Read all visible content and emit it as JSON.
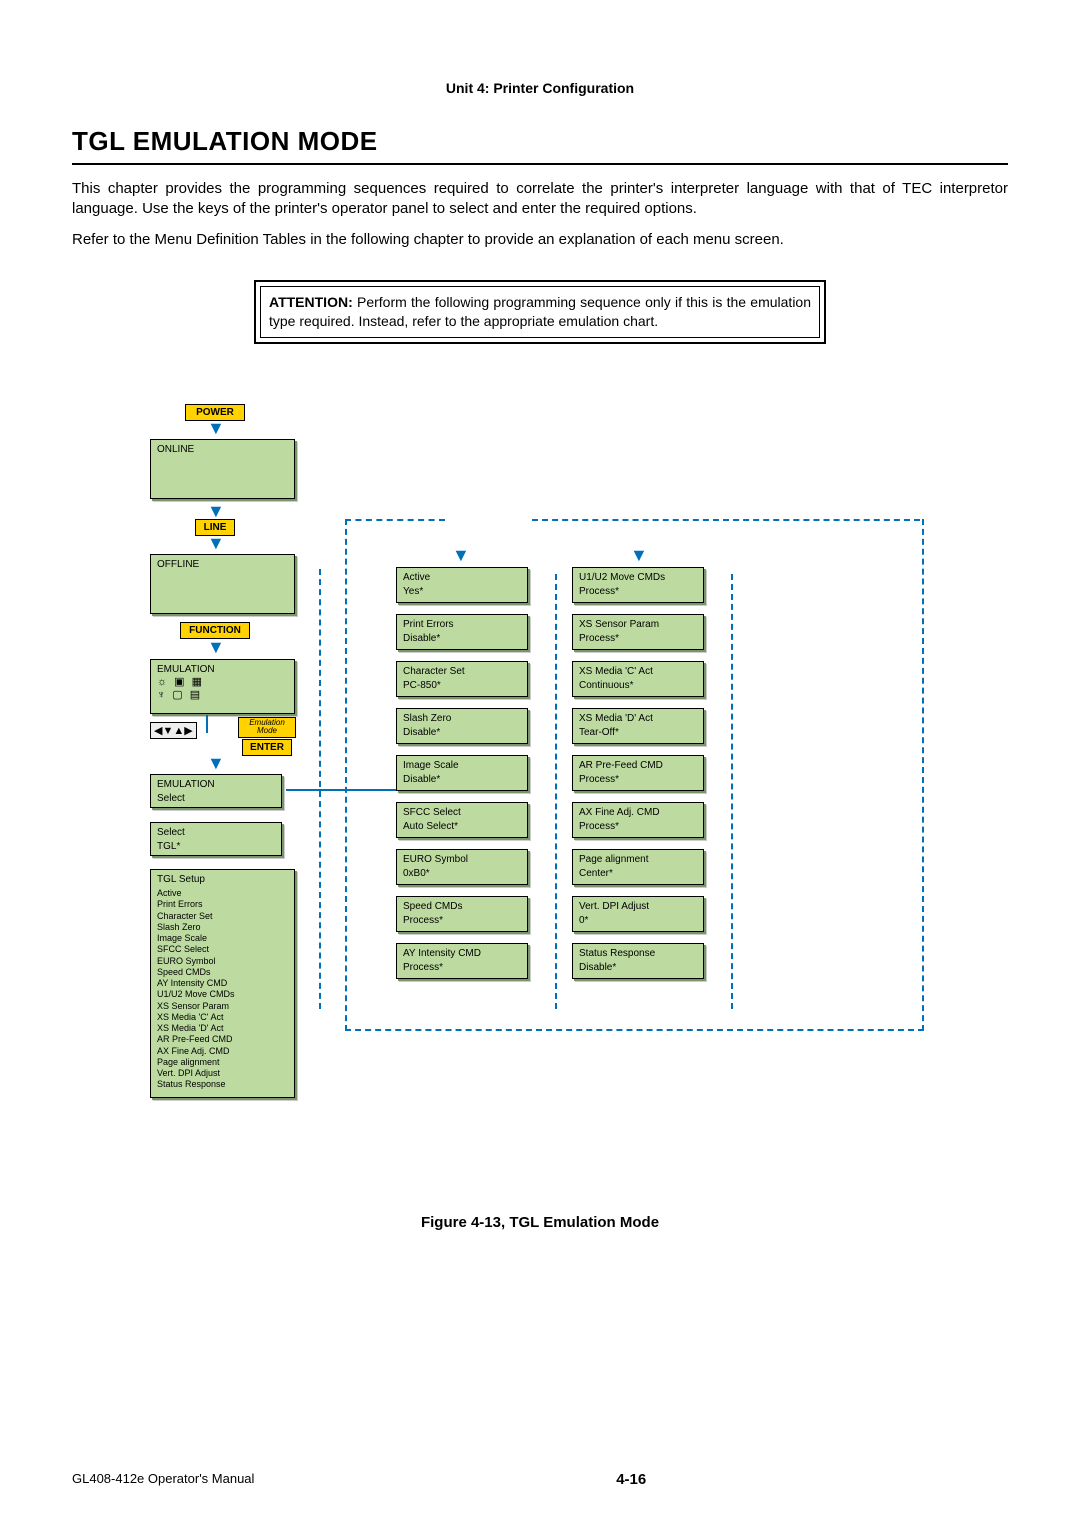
{
  "unit_label": "Unit 4: Printer Configuration",
  "title": "TGL EMULATION MODE",
  "intro": {
    "p1": "This chapter provides the programming sequences required to correlate the printer's interpreter language with that of TEC interpretor language. Use the keys of the printer's operator panel to select and enter the required options.",
    "p2": "Refer to the Menu Definition Tables in the following chapter to provide an explanation of each menu screen."
  },
  "attention": {
    "label": "ATTENTION:",
    "body": "Perform the following programming sequence only if this is the emulation type required. Instead, refer to the appropriate emulation chart."
  },
  "buttons": {
    "power": "POWER",
    "line": "LINE",
    "function": "FUNCTION",
    "enter": "ENTER"
  },
  "screens": {
    "online": "ONLINE",
    "offline": "OFFLINE",
    "emulation_title": "EMULATION",
    "emu_mode_label": "Emulation Mode",
    "emulation_select": {
      "t": "EMULATION",
      "v": "Select"
    },
    "select_tgl": {
      "t": "Select",
      "v": "TGL*"
    },
    "tgl_setup": {
      "title": "TGL Setup",
      "items": [
        "Active",
        "Print Errors",
        "Character Set",
        "Slash Zero",
        "Image Scale",
        "SFCC Select",
        "EURO Symbol",
        "Speed CMDs",
        "AY Intensity CMD",
        "U1/U2 Move CMDs",
        "XS Sensor Param",
        "XS Media 'C' Act",
        "XS Media 'D' Act",
        "AR Pre-Feed CMD",
        "AX Fine Adj. CMD",
        "Page alignment",
        "Vert. DPI Adjust",
        "Status Response"
      ]
    }
  },
  "col2": [
    {
      "t": "Active",
      "v": "Yes*"
    },
    {
      "t": "Print Errors",
      "v": "Disable*"
    },
    {
      "t": "Character Set",
      "v": "PC-850*"
    },
    {
      "t": "Slash Zero",
      "v": "Disable*"
    },
    {
      "t": "Image Scale",
      "v": "Disable*"
    },
    {
      "t": "SFCC Select",
      "v": "Auto Select*"
    },
    {
      "t": "EURO Symbol",
      "v": "0xB0*"
    },
    {
      "t": "Speed CMDs",
      "v": "Process*"
    },
    {
      "t": "AY Intensity CMD",
      "v": "Process*"
    }
  ],
  "col3": [
    {
      "t": "U1/U2 Move CMDs",
      "v": "Process*"
    },
    {
      "t": "XS Sensor Param",
      "v": "Process*"
    },
    {
      "t": "XS Media 'C' Act",
      "v": "Continuous*"
    },
    {
      "t": "XS Media 'D' Act",
      "v": "Tear-Off*"
    },
    {
      "t": "AR Pre-Feed CMD",
      "v": "Process*"
    },
    {
      "t": "AX Fine Adj. CMD",
      "v": "Process*"
    },
    {
      "t": "Page alignment",
      "v": "Center*"
    },
    {
      "t": "Vert. DPI Adjust",
      "v": "0*"
    },
    {
      "t": "Status Response",
      "v": "Disable*"
    }
  ],
  "figure_caption": "Figure 4-13, TGL Emulation Mode",
  "footer": {
    "manual": "GL408-412e Operator's Manual",
    "page": "4-16"
  }
}
